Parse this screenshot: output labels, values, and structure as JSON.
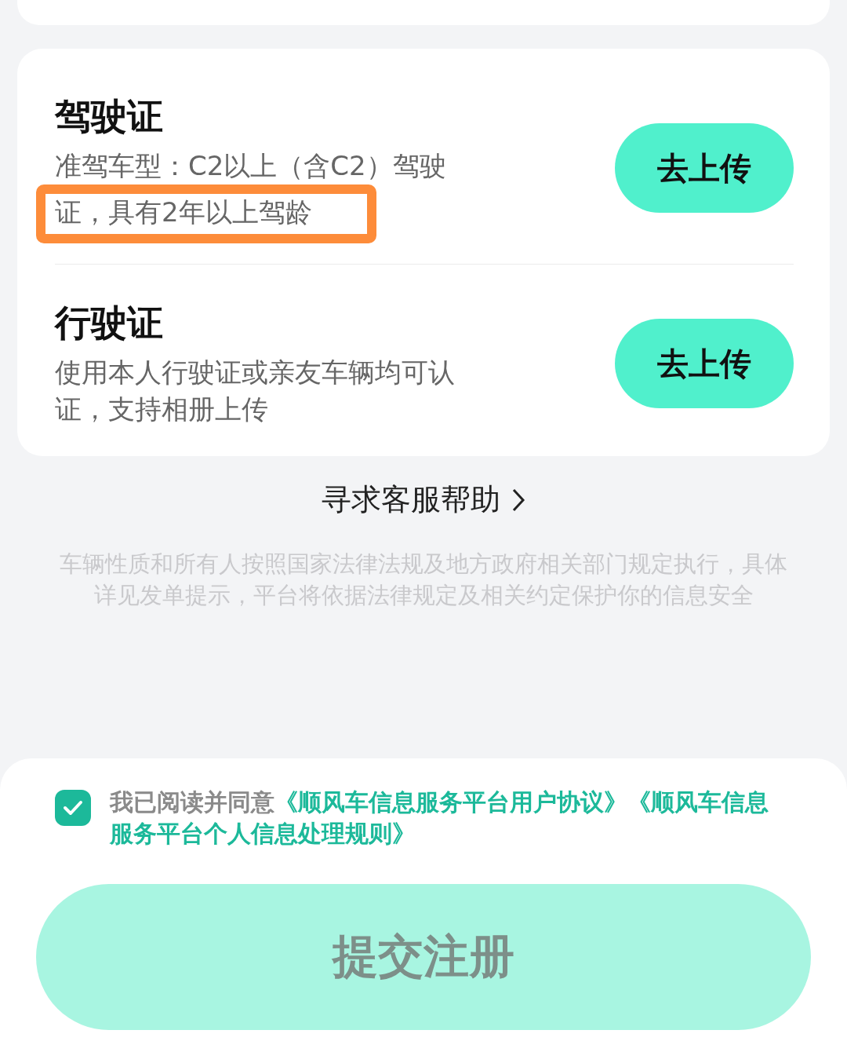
{
  "documents": [
    {
      "title": "驾驶证",
      "desc_lines": [
        {
          "text": "准驾车型：C2以上（含C2）驾驶",
          "highlighted": false
        },
        {
          "text": "证，具有2年以上驾龄",
          "highlighted": true
        }
      ],
      "button": "去上传"
    },
    {
      "title": "行驶证",
      "desc_lines": [
        {
          "text": "使用本人行驶证或亲友车辆均可认",
          "highlighted": false
        },
        {
          "text": "证，支持相册上传",
          "highlighted": false
        }
      ],
      "button": "去上传"
    }
  ],
  "help_link": "寻求客服帮助",
  "notice": "车辆性质和所有人按照国家法律法规及地方政府相关部门规定执行，具体详见发单提示，平台将依据法律规定及相关约定保护你的信息安全",
  "agreement": {
    "checked": true,
    "prefix": "我已阅读并同意",
    "links": [
      "《顺风车信息服务平台用户协议》",
      "《顺风车信息服务平台个人信息处理规则》"
    ]
  },
  "submit_button": "提交注册"
}
